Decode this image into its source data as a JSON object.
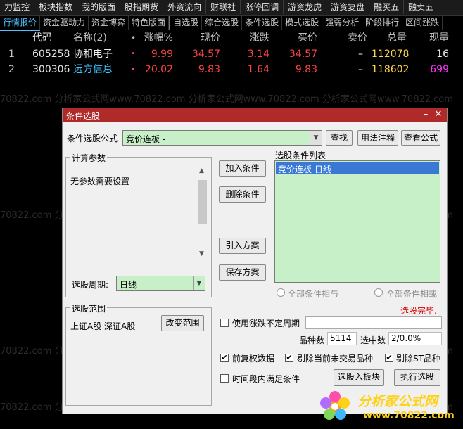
{
  "toolbar": [
    "力监控",
    "板块指数",
    "我的版面",
    "股指期货",
    "外资流向",
    "财联社",
    "涨停回调",
    "游资龙虎",
    "游资复盘",
    "融买五",
    "融卖五"
  ],
  "tabs": [
    "行情报价",
    "资金驱动力",
    "资金博弈",
    "特色版面",
    "自选股",
    "综合选股",
    "条件选股",
    "模式选股",
    "强弱分析",
    "阶段排行",
    "区间涨跌"
  ],
  "table": {
    "headers": {
      "code": "代码",
      "name": "名称(2)",
      "dot": "•",
      "pct": "涨幅%",
      "price": "现价",
      "chg": "涨跌",
      "buy": "买价",
      "sell": "卖价",
      "vol": "总量",
      "cur": "现量"
    },
    "rows": [
      {
        "no": "1",
        "code": "605258",
        "name": "协和电子",
        "dot": "•",
        "pct": "9.99",
        "price": "34.57",
        "chg": "3.14",
        "buy": "34.57",
        "sell": "–",
        "vol": "112078",
        "cur": "16"
      },
      {
        "no": "2",
        "code": "300306",
        "name": "远方信息",
        "dot": "•",
        "pct": "20.02",
        "price": "9.83",
        "chg": "1.64",
        "buy": "9.83",
        "sell": "–",
        "vol": "118602",
        "cur": "699"
      }
    ]
  },
  "watermark": "70822.com 分析家公式网www.70822.com 分析家公式网www.70822.com 分析家公式网www.70822.com",
  "dialog": {
    "title": "条件选股",
    "formula_label": "条件选股公式",
    "formula_value": "竞价连板  -",
    "find_btn": "查找",
    "usage_btn": "用法注释",
    "view_btn": "查看公式",
    "params_title": "计算参数",
    "params_text": "无参数需要设置",
    "add_btn": "加入条件",
    "del_btn": "删除条件",
    "import_btn": "引入方案",
    "save_btn": "保存方案",
    "cond_list_title": "选股条件列表",
    "cond_items": [
      "竞价连板  日线"
    ],
    "period_label": "选股周期:",
    "period_value": "日线",
    "radio_and": "全部条件相与",
    "radio_or": "全部条件相或",
    "status": "选股完毕.",
    "range_title": "选股范围",
    "range_text": "上证A股 深证A股",
    "change_range_btn": "改变范围",
    "uncertain_period": "使用涨跌不定周期",
    "count_label": "品种数",
    "count_value": "5114",
    "selected_label": "选中数",
    "selected_value": "2/0.0%",
    "fuquan": "前复权数据",
    "exclude_untraded": "剔除当前未交易品种",
    "exclude_st": "剔除ST品种",
    "time_cond": "时间段内满足条件",
    "to_block_btn": "选股入板块",
    "exec_btn": "执行选股"
  },
  "logo": {
    "brand": "分析家公式网",
    "url": "www.70822.com"
  }
}
